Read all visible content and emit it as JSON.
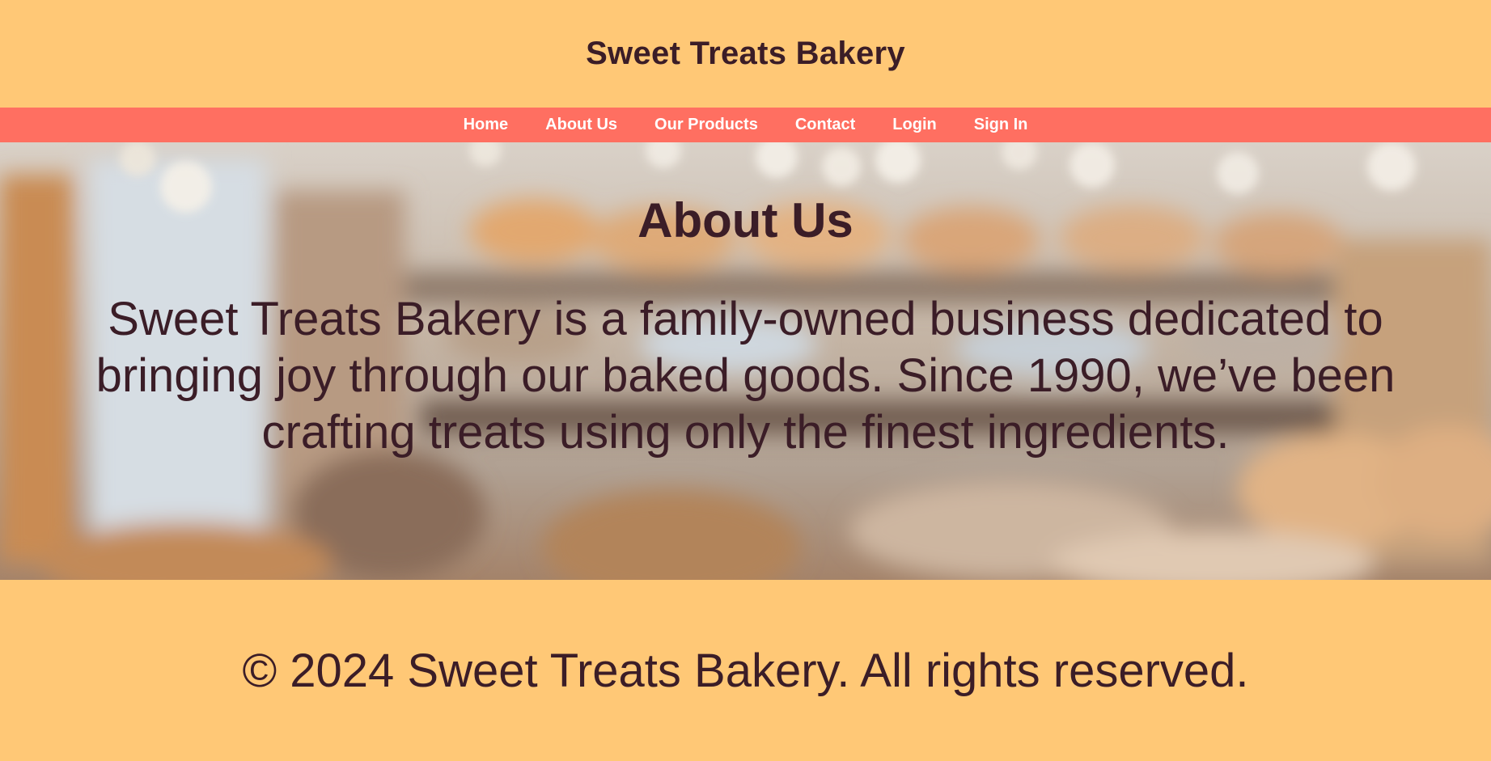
{
  "header": {
    "title": "Sweet Treats Bakery"
  },
  "nav": {
    "items": [
      {
        "label": "Home"
      },
      {
        "label": "About Us"
      },
      {
        "label": "Our Products"
      },
      {
        "label": "Contact"
      },
      {
        "label": "Login"
      },
      {
        "label": "Sign In"
      }
    ]
  },
  "hero": {
    "heading": "About Us",
    "text": "Sweet Treats Bakery is a family-owned business dedicated to bringing joy through our baked goods. Since 1990, we’ve been crafting treats using only the finest ingredients.",
    "background": "blurred-bakery-interior-image"
  },
  "footer": {
    "text": "© 2024 Sweet Treats Bakery. All rights reserved."
  },
  "colors": {
    "page_background": "#ffc876",
    "nav_background": "#ff6f61",
    "nav_text": "#ffffff",
    "text_dark": "#3b1d27"
  }
}
